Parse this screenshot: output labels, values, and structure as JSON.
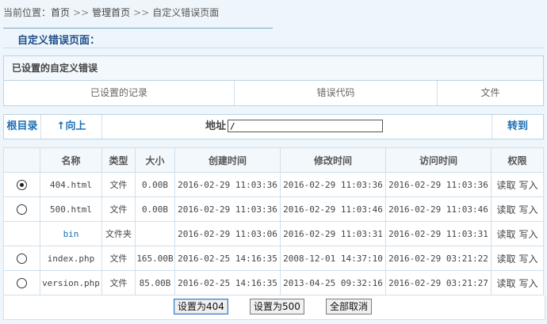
{
  "breadcrumb": {
    "prefix": "当前位置：",
    "items": [
      "首页",
      "管理首页",
      "自定义错误页面"
    ],
    "separator": ">>"
  },
  "page_title": "自定义错误页面：",
  "panel": {
    "title": "已设置的自定义错误",
    "columns": [
      "已设置的记录",
      "错误代码",
      "文件"
    ]
  },
  "nav": {
    "root_label": "根目录",
    "up_label": "↑向上",
    "address_label": "地址",
    "address_value": "/",
    "go_label": "转到"
  },
  "table": {
    "headers": [
      "",
      "名称",
      "类型",
      "大小",
      "创建时间",
      "修改时间",
      "访问时间",
      "权限"
    ],
    "rows": [
      {
        "selected": true,
        "has_radio": true,
        "name": "404.html",
        "is_dir": false,
        "type": "文件",
        "size": "0.00B",
        "created": "2016-02-29 11:03:36",
        "modified": "2016-02-29 11:03:36",
        "accessed": "2016-02-29 11:03:36",
        "read": "读取",
        "write": "写入"
      },
      {
        "selected": false,
        "has_radio": true,
        "name": "500.html",
        "is_dir": false,
        "type": "文件",
        "size": "0.00B",
        "created": "2016-02-29 11:03:36",
        "modified": "2016-02-29 11:03:46",
        "accessed": "2016-02-29 11:03:46",
        "read": "读取",
        "write": "写入"
      },
      {
        "selected": false,
        "has_radio": false,
        "name": "bin",
        "is_dir": true,
        "type": "文件夹",
        "size": "",
        "created": "2016-02-29 11:03:06",
        "modified": "2016-02-29 11:03:31",
        "accessed": "2016-02-29 11:03:31",
        "read": "读取",
        "write": "写入"
      },
      {
        "selected": false,
        "has_radio": true,
        "name": "index.php",
        "is_dir": false,
        "type": "文件",
        "size": "165.00B",
        "created": "2016-02-25 14:16:35",
        "modified": "2008-12-01 14:37:10",
        "accessed": "2016-02-29 03:21:22",
        "read": "读取",
        "write": "写入"
      },
      {
        "selected": false,
        "has_radio": true,
        "name": "version.php",
        "is_dir": false,
        "type": "文件",
        "size": "85.00B",
        "created": "2016-02-25 14:16:35",
        "modified": "2013-04-25 09:32:16",
        "accessed": "2016-02-29 03:21:27",
        "read": "读取",
        "write": "写入"
      }
    ]
  },
  "buttons": {
    "set404": "设置为404",
    "set500": "设置为500",
    "cancel_all": "全部取消"
  }
}
